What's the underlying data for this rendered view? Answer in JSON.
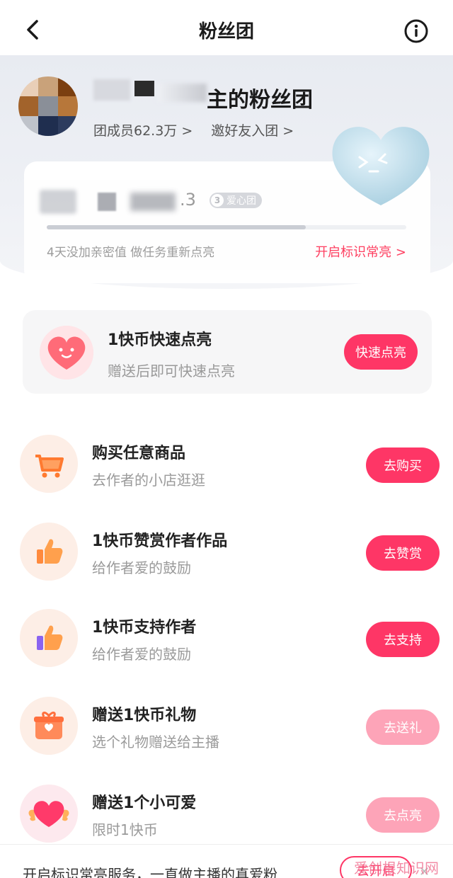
{
  "nav": {
    "title": "粉丝团"
  },
  "header": {
    "group_name_visible": "主的粉丝团",
    "members": "团成员62.3万 >",
    "invite": "邀好友入团 >"
  },
  "card": {
    "user_suffix": ".3",
    "badge_level": "3",
    "badge_label": "爱心团",
    "progress": 0.72,
    "hint": "4天没加亲密值 做任务重新点亮",
    "cta": "开启标识常亮 >"
  },
  "quick": {
    "title": "1快币快速点亮",
    "subtitle": "赠送后即可快速点亮",
    "button": "快速点亮"
  },
  "tasks": [
    {
      "icon": "shopping-cart-icon",
      "title": "购买任意商品",
      "subtitle": "去作者的小店逛逛",
      "button": "去购买",
      "active": true
    },
    {
      "icon": "thumbs-up-icon",
      "title": "1快币赞赏作者作品",
      "subtitle": "给作者爱的鼓励",
      "button": "去赞赏",
      "active": true
    },
    {
      "icon": "thumbs-up-purple-icon",
      "title": "1快币支持作者",
      "subtitle": "给作者爱的鼓励",
      "button": "去支持",
      "active": true
    },
    {
      "icon": "gift-icon",
      "title": "赠送1快币礼物",
      "subtitle": "选个礼物赠送给主播",
      "button": "去送礼",
      "active": false
    },
    {
      "icon": "winged-heart-icon",
      "title": "赠送1个小可爱",
      "subtitle": "限时1快币",
      "button": "去点亮",
      "active": false
    }
  ],
  "footer": {
    "text": "开启标识常亮服务，一直做主播的真爱粉",
    "button": "去开启"
  },
  "watermark": "爱创根知识网",
  "colors": {
    "accent": "#fe3666",
    "accent_faded": "#fda4b8"
  }
}
